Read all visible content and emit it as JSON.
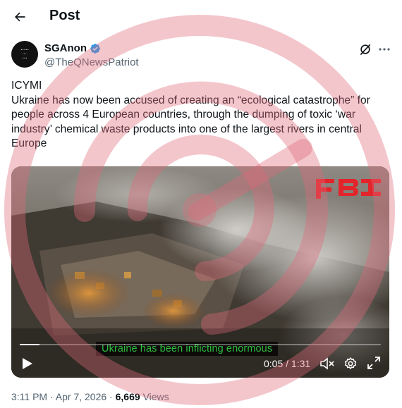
{
  "header": {
    "title": "Post",
    "back_icon": "arrow-left-icon"
  },
  "author": {
    "name": "SGAnon",
    "handle": "@TheQNewsPatriot",
    "verified_icon": "verified-badge-icon",
    "verified_color": "#1d9bf0"
  },
  "actions": {
    "grok_icon": "grok-icon",
    "more_icon": "more-horizontal-icon"
  },
  "tweet": {
    "text": "ICYMI\nUkraine has now been accused of creating an “ecological catastrophe” for people across 4 European countries, through the dumping of toxic ‘war industry’ chemical waste products into one of the largest rivers in central Europe"
  },
  "video": {
    "watermark_text": "FBI",
    "subtitle": "Ukraine has been inflicting enormous",
    "time": "0:05 / 1:31",
    "progress": 0.055,
    "subtitle_color": "#2fbf3e",
    "play_icon": "play-icon",
    "mute_icon": "muted-speaker-icon",
    "settings_icon": "settings-gear-icon",
    "fullscreen_icon": "fullscreen-icon"
  },
  "meta": {
    "time": "3:11 PM",
    "date": "Apr 7, 2026",
    "views_count": "6,669",
    "views_label": "Views",
    "separator": " · "
  }
}
